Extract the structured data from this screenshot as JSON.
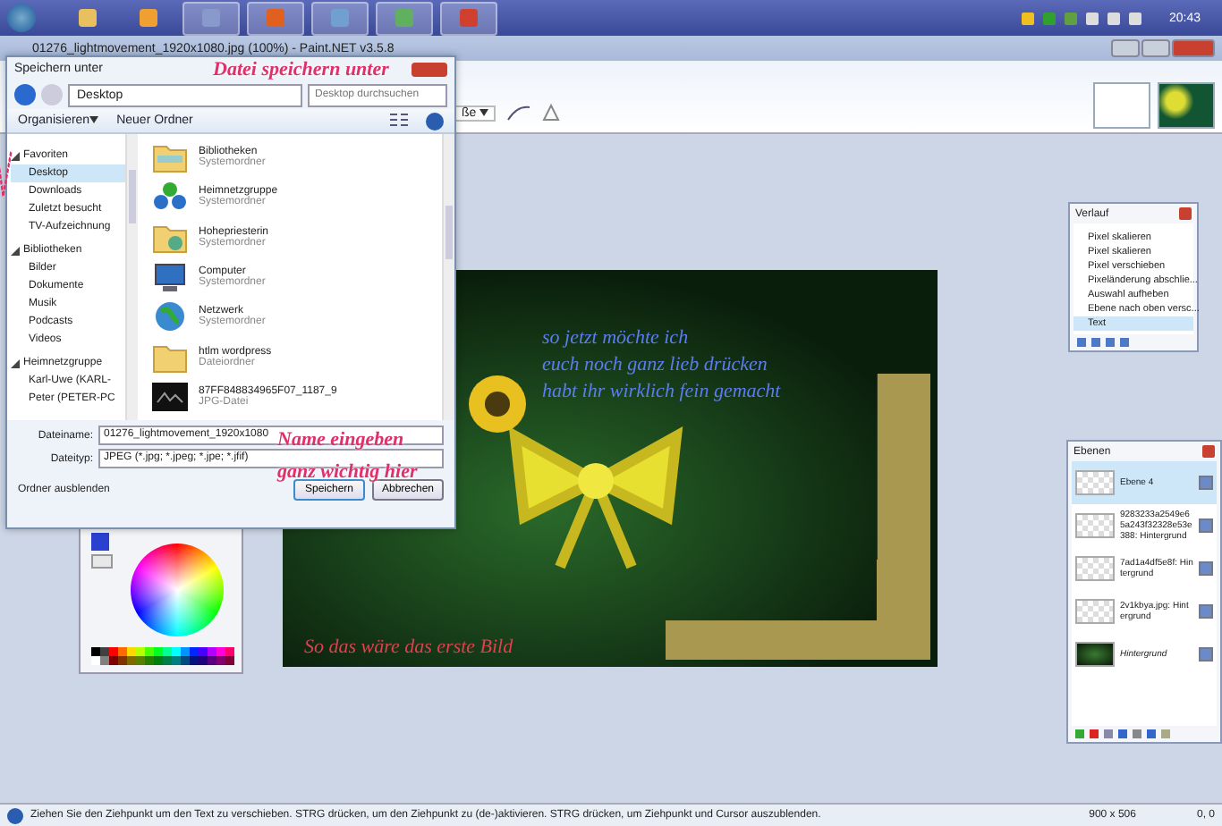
{
  "taskbar": {
    "clock": "20:43"
  },
  "window": {
    "title": "01276_lightmovement_1920x1080.jpg (100%) - Paint.NET v3.5.8"
  },
  "toolbar": {
    "font_size": "ße"
  },
  "canvas": {
    "texts": [
      {
        "text": "so jetzt möchte ich",
        "kind": "blue"
      },
      {
        "text": "euch noch ganz lieb drücken",
        "kind": "blue"
      },
      {
        "text": "habt ihr wirklich fein gemacht",
        "kind": "blue"
      },
      {
        "text": "So das wäre das erste Bild",
        "kind": "red"
      }
    ]
  },
  "save_dialog": {
    "title": "Speichern unter",
    "address": "Desktop",
    "search": {
      "placeholder": "Desktop durchsuchen"
    },
    "toolbar": [
      "Organisieren",
      "Neuer Ordner"
    ],
    "nav": [
      {
        "label": "Favoriten",
        "expanded": true,
        "selected": false,
        "children": [
          {
            "label": "Desktop",
            "selected": true
          },
          {
            "label": "Downloads",
            "selected": false
          },
          {
            "label": "Zuletzt besucht",
            "selected": false
          },
          {
            "label": "TV-Aufzeichnung",
            "selected": false
          }
        ]
      },
      {
        "label": "Bibliotheken",
        "expanded": true,
        "selected": false,
        "children": [
          {
            "label": "Bilder",
            "selected": false
          },
          {
            "label": "Dokumente",
            "selected": false
          },
          {
            "label": "Musik",
            "selected": false
          },
          {
            "label": "Podcasts",
            "selected": false
          },
          {
            "label": "Videos",
            "selected": false
          }
        ]
      },
      {
        "label": "Heimnetzgruppe",
        "expanded": true,
        "selected": false,
        "children": [
          {
            "label": "Karl-Uwe (KARL-",
            "selected": false
          },
          {
            "label": "Peter (PETER-PC",
            "selected": false
          }
        ]
      }
    ],
    "files": [
      {
        "name": "Bibliotheken",
        "type": "Systemordner",
        "kind": "library"
      },
      {
        "name": "Heimnetzgruppe",
        "type": "Systemordner",
        "kind": "homegroup"
      },
      {
        "name": "Hohepriesterin",
        "type": "Systemordner",
        "kind": "user"
      },
      {
        "name": "Computer",
        "type": "Systemordner",
        "kind": "computer"
      },
      {
        "name": "Netzwerk",
        "type": "Systemordner",
        "kind": "network"
      },
      {
        "name": "htlm wordpress",
        "type": "Dateiordner",
        "kind": "folder"
      },
      {
        "name": "87FF848834965F07_1187_9",
        "type": "JPG-Datei",
        "kind": "image"
      }
    ],
    "filename_label": "Dateiname:",
    "filename": "01276_lightmovement_1920x1080",
    "filetype_label": "Dateityp:",
    "filetype": "JPEG (*.jpg; *.jpeg; *.jpe; *.jfif)",
    "hide_folders": "Ordner ausblenden",
    "buttons": [
      "Speichern",
      "Abbrechen"
    ]
  },
  "annotations": [
    "Datei speichern unter",
    "Name eingeben",
    "ganz wichtig hier"
  ],
  "history": {
    "title": "Verlauf",
    "items": [
      {
        "label": "Pixel skalieren",
        "selected": false
      },
      {
        "label": "Pixel skalieren",
        "selected": false
      },
      {
        "label": "Pixel verschieben",
        "selected": false
      },
      {
        "label": "Pixeländerung abschlie...",
        "selected": false
      },
      {
        "label": "Auswahl aufheben",
        "selected": false
      },
      {
        "label": "Ebene nach oben versc...",
        "selected": false
      },
      {
        "label": "Text",
        "selected": true
      }
    ]
  },
  "layers": {
    "title": "Ebenen",
    "items": [
      {
        "name": "Ebene 4",
        "selected": true,
        "checked": true,
        "kind": "transparent",
        "italic": false
      },
      {
        "name": "9283233a2549e65a243f32328e53e388: Hintergrund",
        "selected": false,
        "checked": true,
        "kind": "transparent",
        "italic": false
      },
      {
        "name": "7ad1a4df5e8f: Hintergrund",
        "selected": false,
        "checked": true,
        "kind": "transparent",
        "italic": false
      },
      {
        "name": "2v1kbya.jpg: Hintergrund",
        "selected": false,
        "checked": true,
        "kind": "transparent",
        "italic": false
      },
      {
        "name": "Hintergrund",
        "selected": false,
        "checked": true,
        "kind": "photo",
        "italic": true
      }
    ]
  },
  "status_bar": {
    "hint": "Ziehen Sie den Ziehpunkt um den Text zu verschieben. STRG drücken, um den Ziehpunkt zu (de-)aktivieren. STRG drücken, um Ziehpunkt und Cursor auszublenden.",
    "size": "900 x 506",
    "position": "0, 0"
  }
}
